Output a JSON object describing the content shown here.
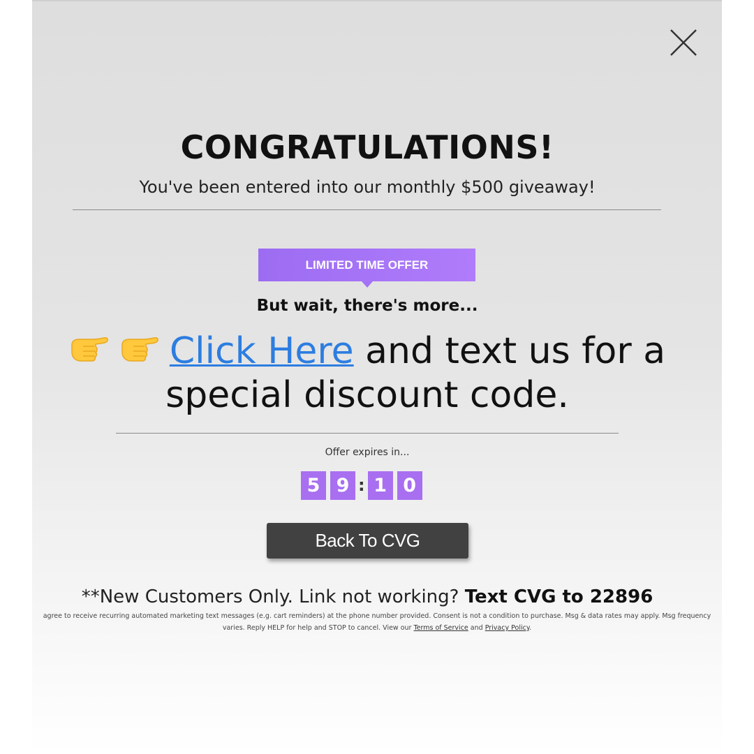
{
  "popup": {
    "close_icon": "close-icon",
    "title": "CONGRATULATIONS!",
    "subtitle": "You've been entered into our monthly $500 giveaway!",
    "badge": "LIMITED TIME OFFER",
    "wait_text": "But wait, there's more...",
    "hand_icon": "pointing-right-hand-emoji",
    "link_text": "Click Here",
    "cta_rest_line1": " and text us for a",
    "cta_line2": "special discount code.",
    "expires_text": "Offer expires in...",
    "timer": {
      "d1": "5",
      "d2": "9",
      "separator": ":",
      "d3": "1",
      "d4": "0"
    },
    "back_button": "Back To CVG",
    "new_customers_prefix": "**New Customers Only. Link not working? ",
    "new_customers_bold": "Text CVG to 22896",
    "legal_line1": "agree to receive recurring automated marketing text messages (e.g. cart reminders) at the phone number provided. Consent is not a condition to purchase. Msg & data rates may apply. Msg frequency",
    "legal_line2_prefix": "varies. Reply HELP for help and STOP to cancel. View our ",
    "terms_link": "Terms of Service",
    "and_text": " and ",
    "privacy_link": "Privacy Policy",
    "period": "."
  },
  "colors": {
    "accent_purple": "#a86ff0",
    "link_blue": "#2c7de0",
    "button_dark": "#414141"
  }
}
